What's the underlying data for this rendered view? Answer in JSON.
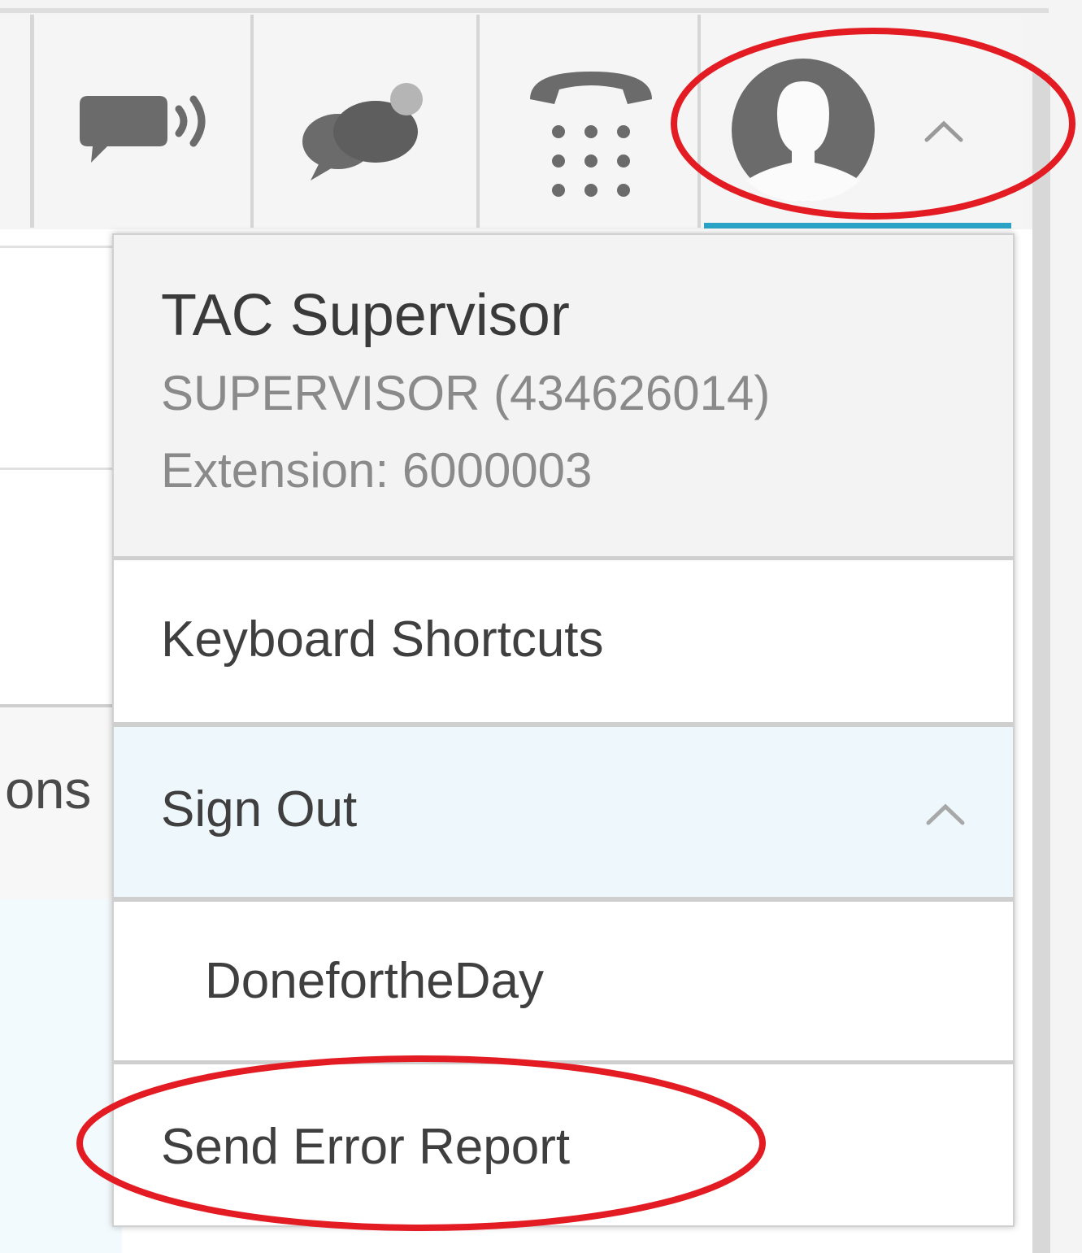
{
  "toolbar": {
    "icons": [
      "chat-sound-icon",
      "team-chat-icon",
      "dialpad-icon",
      "agent-avatar-icon",
      "chevron-up-icon"
    ],
    "active_indicator_color": "#2ba3c6"
  },
  "background": {
    "partial_label": "ons"
  },
  "user": {
    "name": "TAC Supervisor",
    "role_line": "SUPERVISOR (434626014)",
    "extension_line": "Extension: 6000003"
  },
  "menu": {
    "keyboard_shortcuts": "Keyboard Shortcuts",
    "sign_out": "Sign Out",
    "sign_out_reason": "DonefortheDay",
    "send_error_report": "Send Error Report"
  },
  "colors": {
    "annotation": "#e31b23",
    "selected_row": "#eef8fc",
    "icon_gray": "#6b6b6b"
  }
}
